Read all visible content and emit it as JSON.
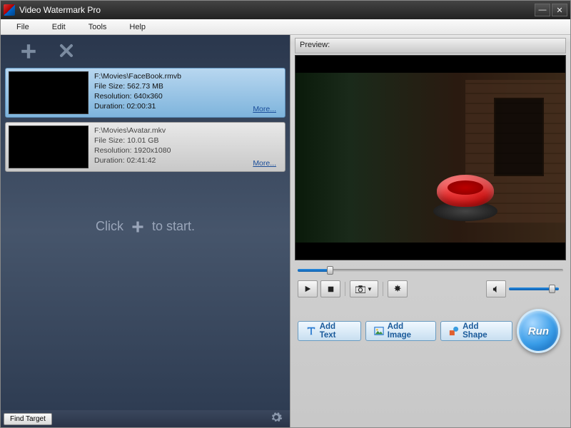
{
  "window": {
    "title": "Video Watermark Pro"
  },
  "menu": {
    "file": "File",
    "edit": "Edit",
    "tools": "Tools",
    "help": "Help"
  },
  "files": {
    "item0": {
      "path": "F:\\Movies\\FaceBook.rmvb",
      "size_label": "File Size: 562.73 MB",
      "resolution_label": "Resolution: 640x360",
      "duration_label": "Duration: 02:00:31",
      "more": "More..."
    },
    "item1": {
      "path": "F:\\Movies\\Avatar.mkv",
      "size_label": "File Size: 10.01 GB",
      "resolution_label": "Resolution: 1920x1080",
      "duration_label": "Duration: 02:41:42",
      "more": "More..."
    }
  },
  "hint": {
    "prefix": "Click",
    "suffix": "to start."
  },
  "left_status": {
    "find_target": "Find Target"
  },
  "preview": {
    "label": "Preview:"
  },
  "watermark": {
    "add_text": "Add Text",
    "add_image": "Add Image",
    "add_shape": "Add Shape"
  },
  "run": "Run"
}
